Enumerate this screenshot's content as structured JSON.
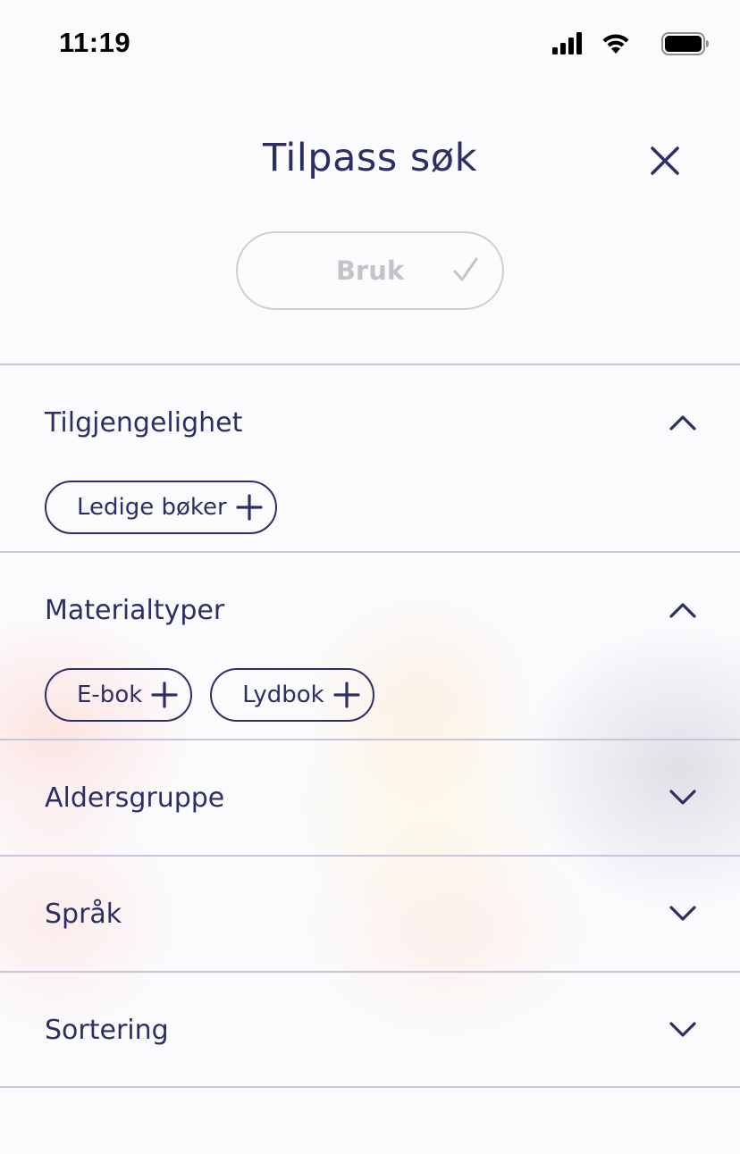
{
  "status_bar": {
    "time": "11:19",
    "icons": [
      "signal-icon",
      "wifi-icon",
      "battery-icon"
    ]
  },
  "header": {
    "title": "Tilpass søk",
    "close_icon": "close-icon"
  },
  "apply_button": {
    "label": "Bruk",
    "icon": "check-icon",
    "enabled": false
  },
  "sections": [
    {
      "title": "Tilgjengelighet",
      "expanded": true,
      "options": [
        "Ledige bøker"
      ]
    },
    {
      "title": "Materialtyper",
      "expanded": true,
      "options": [
        "E-bok",
        "Lydbok"
      ]
    },
    {
      "title": "Aldersgruppe",
      "expanded": false,
      "options": []
    },
    {
      "title": "Språk",
      "expanded": false,
      "options": []
    },
    {
      "title": "Sortering",
      "expanded": false,
      "options": []
    }
  ],
  "colors": {
    "primary": "#2c2f66",
    "divider": "#c6c7dc",
    "disabled": "#c4c4c8"
  }
}
